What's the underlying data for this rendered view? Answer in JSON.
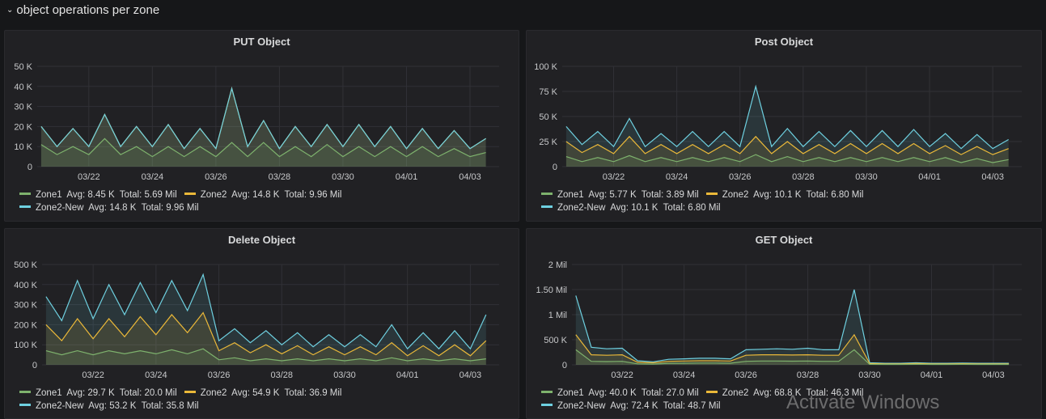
{
  "row": {
    "title": "object operations per zone",
    "collapse_icon": "chevron-down-icon"
  },
  "colors": {
    "Zone1": "#7eb26d",
    "Zone2": "#eab839",
    "Zone2-New": "#6ed0e0",
    "background": "#161719",
    "panel": "#212124"
  },
  "watermark": "Activate Windows",
  "x": [
    "03/20 12:00",
    "03/21 00:00",
    "03/21 12:00",
    "03/22 00:00",
    "03/22 12:00",
    "03/23 00:00",
    "03/23 12:00",
    "03/24 00:00",
    "03/24 12:00",
    "03/25 00:00",
    "03/25 12:00",
    "03/26 00:00",
    "03/26 12:00",
    "03/27 00:00",
    "03/27 12:00",
    "03/28 00:00",
    "03/28 12:00",
    "03/29 00:00",
    "03/29 12:00",
    "03/30 00:00",
    "03/30 12:00",
    "03/31 00:00",
    "03/31 12:00",
    "04/01 00:00",
    "04/01 12:00",
    "04/02 00:00",
    "04/02 12:00",
    "04/03 00:00",
    "04/03 12:00"
  ],
  "xlim": [
    "03/20 09:00",
    "04/03 22:00"
  ],
  "xticks": [
    "03/22",
    "03/24",
    "03/26",
    "03/28",
    "03/30",
    "04/01",
    "04/03"
  ],
  "chart_data": [
    {
      "type": "area",
      "title": "PUT Object",
      "ylim": [
        0,
        50000
      ],
      "yticks": [
        {
          "v": 0,
          "label": "0"
        },
        {
          "v": 10000,
          "label": "10 K"
        },
        {
          "v": 20000,
          "label": "20 K"
        },
        {
          "v": 30000,
          "label": "30 K"
        },
        {
          "v": 40000,
          "label": "40 K"
        },
        {
          "v": 50000,
          "label": "50 K"
        }
      ],
      "grid": true,
      "legend_placement": "bottom",
      "series": [
        {
          "name": "Zone2",
          "avg": "14.8 K",
          "total": "9.96 Mil",
          "values": [
            20000,
            10000,
            19000,
            10000,
            26000,
            10000,
            20000,
            10000,
            21000,
            9000,
            19000,
            9000,
            39000,
            10000,
            23000,
            9000,
            20000,
            10000,
            21000,
            10000,
            21000,
            10000,
            20000,
            9000,
            19000,
            9000,
            18000,
            9000,
            14000
          ]
        },
        {
          "name": "Zone2-New",
          "avg": "14.8 K",
          "total": "9.96 Mil",
          "values": [
            20000,
            10000,
            19000,
            10000,
            26000,
            10000,
            20000,
            10000,
            21000,
            9000,
            19000,
            9000,
            39000,
            10000,
            23000,
            9000,
            20000,
            10000,
            21000,
            10000,
            21000,
            10000,
            20000,
            9000,
            19000,
            9000,
            18000,
            9000,
            14000
          ]
        },
        {
          "name": "Zone1",
          "avg": "8.45 K",
          "total": "5.69 Mil",
          "values": [
            11000,
            6000,
            10000,
            6000,
            14000,
            6000,
            10000,
            5000,
            10000,
            5000,
            10000,
            5000,
            12000,
            5000,
            12000,
            5000,
            10000,
            5000,
            11000,
            5000,
            10000,
            5000,
            10000,
            5000,
            10000,
            5000,
            9000,
            5000,
            7000
          ]
        }
      ]
    },
    {
      "type": "area",
      "title": "Post Object",
      "ylim": [
        0,
        100000
      ],
      "yticks": [
        {
          "v": 0,
          "label": "0"
        },
        {
          "v": 25000,
          "label": "25 K"
        },
        {
          "v": 50000,
          "label": "50 K"
        },
        {
          "v": 75000,
          "label": "75 K"
        },
        {
          "v": 100000,
          "label": "100 K"
        }
      ],
      "grid": true,
      "legend_placement": "bottom",
      "series": [
        {
          "name": "Zone2-New",
          "avg": "10.1 K",
          "total": "6.80 Mil",
          "values": [
            40000,
            22000,
            35000,
            20000,
            48000,
            20000,
            33000,
            20000,
            35000,
            20000,
            35000,
            20000,
            80000,
            20000,
            38000,
            20000,
            35000,
            20000,
            36000,
            20000,
            36000,
            20000,
            37000,
            20000,
            33000,
            18000,
            32000,
            18000,
            27000
          ]
        },
        {
          "name": "Zone2",
          "avg": "10.1 K",
          "total": "6.80 Mil",
          "values": [
            25000,
            14000,
            22000,
            13000,
            30000,
            13000,
            22000,
            13000,
            22000,
            13000,
            22000,
            13000,
            30000,
            13000,
            25000,
            13000,
            22000,
            13000,
            23000,
            13000,
            23000,
            13000,
            23000,
            13000,
            21000,
            12000,
            20000,
            12000,
            18000
          ]
        },
        {
          "name": "Zone1",
          "avg": "5.77 K",
          "total": "3.89 Mil",
          "values": [
            10000,
            5000,
            9000,
            5000,
            11000,
            5000,
            9000,
            5000,
            9000,
            5000,
            9000,
            5000,
            12000,
            5000,
            10000,
            5000,
            9000,
            5000,
            9000,
            5000,
            9000,
            5000,
            9000,
            5000,
            9000,
            4000,
            8000,
            4000,
            7000
          ]
        }
      ]
    },
    {
      "type": "area",
      "title": "Delete Object",
      "ylim": [
        0,
        500000
      ],
      "yticks": [
        {
          "v": 0,
          "label": "0"
        },
        {
          "v": 100000,
          "label": "100 K"
        },
        {
          "v": 200000,
          "label": "200 K"
        },
        {
          "v": 300000,
          "label": "300 K"
        },
        {
          "v": 400000,
          "label": "400 K"
        },
        {
          "v": 500000,
          "label": "500 K"
        }
      ],
      "grid": true,
      "legend_placement": "bottom",
      "series": [
        {
          "name": "Zone2-New",
          "avg": "53.2 K",
          "total": "35.8 Mil",
          "values": [
            340000,
            220000,
            420000,
            230000,
            400000,
            250000,
            410000,
            260000,
            420000,
            270000,
            450000,
            120000,
            180000,
            110000,
            170000,
            100000,
            160000,
            90000,
            150000,
            90000,
            150000,
            90000,
            200000,
            80000,
            160000,
            80000,
            170000,
            80000,
            250000
          ]
        },
        {
          "name": "Zone2",
          "avg": "54.9 K",
          "total": "36.9 Mil",
          "values": [
            200000,
            120000,
            230000,
            130000,
            230000,
            140000,
            240000,
            150000,
            250000,
            160000,
            260000,
            70000,
            110000,
            60000,
            100000,
            55000,
            95000,
            50000,
            90000,
            50000,
            90000,
            50000,
            110000,
            45000,
            95000,
            45000,
            100000,
            45000,
            120000
          ]
        },
        {
          "name": "Zone1",
          "avg": "29.7 K",
          "total": "20.0 Mil",
          "values": [
            70000,
            50000,
            70000,
            50000,
            70000,
            55000,
            70000,
            55000,
            75000,
            55000,
            80000,
            25000,
            35000,
            20000,
            30000,
            20000,
            30000,
            20000,
            30000,
            20000,
            30000,
            20000,
            35000,
            20000,
            30000,
            20000,
            30000,
            20000,
            30000
          ]
        }
      ]
    },
    {
      "type": "area",
      "title": "GET Object",
      "ylim": [
        0,
        2000000
      ],
      "yticks": [
        {
          "v": 0,
          "label": "0"
        },
        {
          "v": 500000,
          "label": "500 K"
        },
        {
          "v": 1000000,
          "label": "1 Mil"
        },
        {
          "v": 1500000,
          "label": "1.50 Mil"
        },
        {
          "v": 2000000,
          "label": "2 Mil"
        }
      ],
      "grid": true,
      "legend_placement": "bottom",
      "series": [
        {
          "name": "Zone2-New",
          "avg": "72.4 K",
          "total": "48.7 Mil",
          "values": [
            1380000,
            350000,
            320000,
            330000,
            80000,
            60000,
            110000,
            120000,
            130000,
            130000,
            120000,
            300000,
            310000,
            320000,
            310000,
            330000,
            300000,
            300000,
            1500000,
            40000,
            30000,
            30000,
            40000,
            30000,
            30000,
            35000,
            30000,
            30000,
            30000
          ]
        },
        {
          "name": "Zone2",
          "avg": "68.8 K",
          "total": "46.3 Mil",
          "values": [
            600000,
            200000,
            190000,
            200000,
            50000,
            40000,
            70000,
            75000,
            80000,
            80000,
            75000,
            190000,
            200000,
            200000,
            195000,
            200000,
            190000,
            190000,
            600000,
            25000,
            20000,
            20000,
            25000,
            20000,
            20000,
            22000,
            20000,
            20000,
            20000
          ]
        },
        {
          "name": "Zone1",
          "avg": "40.0 K",
          "total": "27.0 Mil",
          "values": [
            300000,
            70000,
            65000,
            70000,
            20000,
            15000,
            30000,
            32000,
            35000,
            35000,
            33000,
            70000,
            75000,
            75000,
            72000,
            75000,
            70000,
            70000,
            300000,
            10000,
            8000,
            8000,
            10000,
            8000,
            8000,
            9000,
            8000,
            8000,
            8000
          ]
        }
      ]
    }
  ],
  "legends": [
    [
      {
        "name": "Zone1",
        "text": "Zone1  Avg: 8.45 K  Total: 5.69 Mil"
      },
      {
        "name": "Zone2",
        "text": "Zone2  Avg: 14.8 K  Total: 9.96 Mil"
      },
      {
        "name": "Zone2-New",
        "text": "Zone2-New  Avg: 14.8 K  Total: 9.96 Mil"
      }
    ],
    [
      {
        "name": "Zone1",
        "text": "Zone1  Avg: 5.77 K  Total: 3.89 Mil"
      },
      {
        "name": "Zone2",
        "text": "Zone2  Avg: 10.1 K  Total: 6.80 Mil"
      },
      {
        "name": "Zone2-New",
        "text": "Zone2-New  Avg: 10.1 K  Total: 6.80 Mil"
      }
    ],
    [
      {
        "name": "Zone1",
        "text": "Zone1  Avg: 29.7 K  Total: 20.0 Mil"
      },
      {
        "name": "Zone2",
        "text": "Zone2  Avg: 54.9 K  Total: 36.9 Mil"
      },
      {
        "name": "Zone2-New",
        "text": "Zone2-New  Avg: 53.2 K  Total: 35.8 Mil"
      }
    ],
    [
      {
        "name": "Zone1",
        "text": "Zone1  Avg: 40.0 K  Total: 27.0 Mil"
      },
      {
        "name": "Zone2",
        "text": "Zone2  Avg: 68.8 K  Total: 46.3 Mil"
      },
      {
        "name": "Zone2-New",
        "text": "Zone2-New  Avg: 72.4 K  Total: 48.7 Mil"
      }
    ]
  ]
}
